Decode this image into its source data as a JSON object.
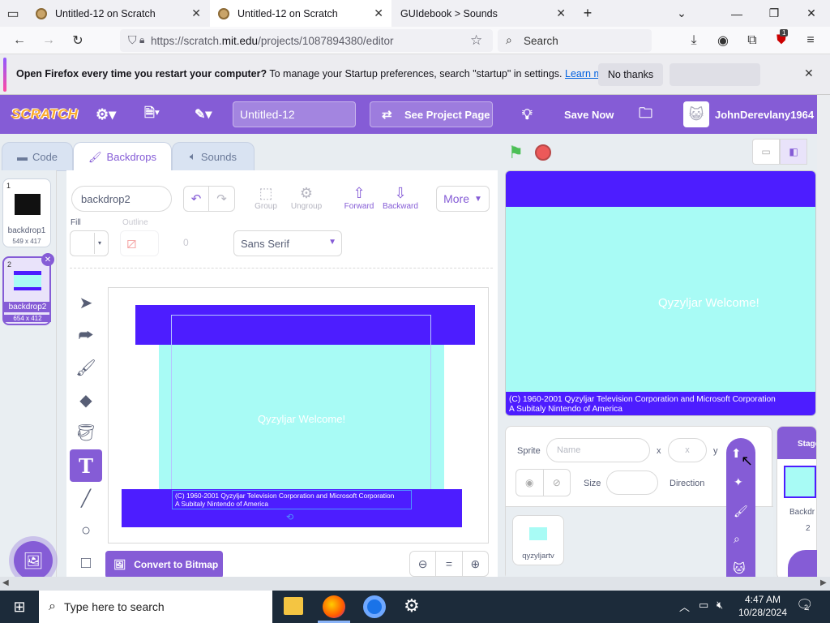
{
  "browser": {
    "tabs": [
      {
        "title": "Untitled-12 on Scratch"
      },
      {
        "title": "Untitled-12 on Scratch"
      },
      {
        "title": "GUIdebook > Sounds"
      }
    ],
    "url_prefix": "https://scratch.",
    "url_domain": "mit.edu",
    "url_path": "/projects/1087894380/editor",
    "search_placeholder": "Search",
    "extension_badge": "1"
  },
  "notification": {
    "bold_text": "Open Firefox every time you restart your computer?",
    "text": " To manage your Startup preferences, search \"startup\" in settings.",
    "link": "Learn more",
    "no_thanks": "No thanks"
  },
  "scratch_header": {
    "logo": "SCRATCH",
    "project_title": "Untitled-12",
    "see_project_page": "See Project Page",
    "save_now": "Save Now",
    "username": "JohnDerevlany1964"
  },
  "editor_tabs": [
    {
      "label": "Code"
    },
    {
      "label": "Backdrops"
    },
    {
      "label": "Sounds"
    }
  ],
  "costumes": [
    {
      "index": "1",
      "name": "backdrop1",
      "size": "549 x 417"
    },
    {
      "index": "2",
      "name": "backdrop2",
      "size": "654 x 412"
    }
  ],
  "paint": {
    "costume_name": "backdrop2",
    "group": "Group",
    "ungroup": "Ungroup",
    "forward": "Forward",
    "backward": "Backward",
    "more": "More",
    "fill_label": "Fill",
    "outline_label": "Outline",
    "outline_value": "0",
    "font": "Sans Serif",
    "convert_bitmap": "Convert to Bitmap",
    "canvas_text_welcome": "Qyzyljar Welcome!",
    "canvas_text_line1": "(C) 1960-2001 Qyzyljar Television Corporation and Microsoft Corporation",
    "canvas_text_line2": "A Subitaly Nintendo of America",
    "zoom_reset": "="
  },
  "stage": {
    "welcome_text": "Qyzyljar Welcome!",
    "footer_line1": "(C) 1960-2001 Qyzyljar Television Corporation and Microsoft Corporation",
    "footer_line2": "A Subitaly Nintendo of America"
  },
  "sprite_info": {
    "sprite_label": "Sprite",
    "name_placeholder": "Name",
    "x_label": "x",
    "x_placeholder": "x",
    "y_label": "y",
    "size_label": "Size",
    "direction_label": "Direction",
    "sprite_name": "qyzyljartv"
  },
  "stage_pane": {
    "label": "Stage",
    "backdrops_label": "Backdr",
    "backdrops_count": "2"
  },
  "taskbar": {
    "search_text": "Type here to search",
    "time": "4:47 AM",
    "date": "10/28/2024",
    "notif_count": "2"
  },
  "colors": {
    "scratch_purple": "#855cd6",
    "banner_blue": "#4d1dff",
    "cyan": "#a8fbf5"
  }
}
